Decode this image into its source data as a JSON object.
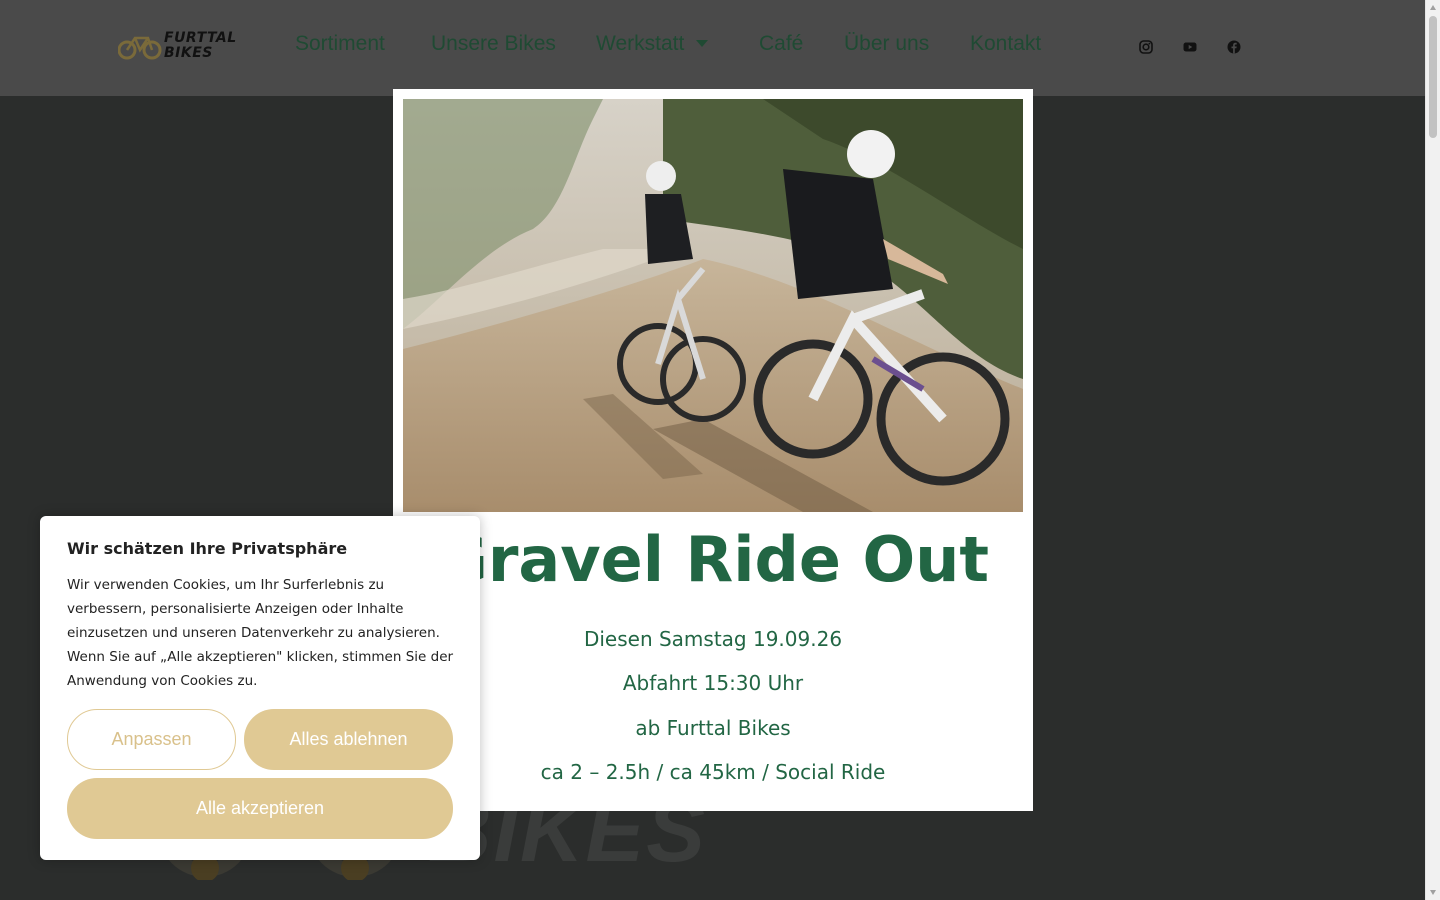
{
  "header": {
    "logo_text_line1": "FURTTAL",
    "logo_text_line2": "BIKES",
    "nav": [
      {
        "label": "Sortiment"
      },
      {
        "label": "Unsere Bikes"
      },
      {
        "label": "Werkstatt"
      },
      {
        "label": "Café"
      },
      {
        "label": "Über uns"
      },
      {
        "label": "Kontakt"
      }
    ],
    "social_icons": [
      "instagram-icon",
      "youtube-icon",
      "facebook-icon"
    ]
  },
  "background": {
    "logo_text": "BIKES"
  },
  "popup": {
    "image_description_icon": "gravel-cyclists-photo",
    "title": "Gravel Ride Out",
    "lines": [
      "Diesen Samstag 19.09.26",
      "Abfahrt 15:30 Uhr",
      "ab Furttal Bikes",
      "ca 2 – 2.5h / ca 45km / Social Ride"
    ]
  },
  "cookie": {
    "title": "Wir schätzen Ihre Privatsphäre",
    "text": "Wir verwenden Cookies, um Ihr Surferlebnis zu verbessern, personalisierte Anzeigen oder Inhalte einzusetzen und unseren Datenverkehr zu analysieren. Wenn Sie auf „Alle akzeptieren\" klicken, stimmen Sie der Anwendung von Cookies zu.",
    "customize_label": "Anpassen",
    "reject_label": "Alles ablehnen",
    "accept_label": "Alle akzeptieren"
  },
  "colors": {
    "header_bg": "#4a4a4a",
    "page_bg": "#2b2d2c",
    "brand_green": "#226644",
    "accent_gold": "#e0c994"
  }
}
